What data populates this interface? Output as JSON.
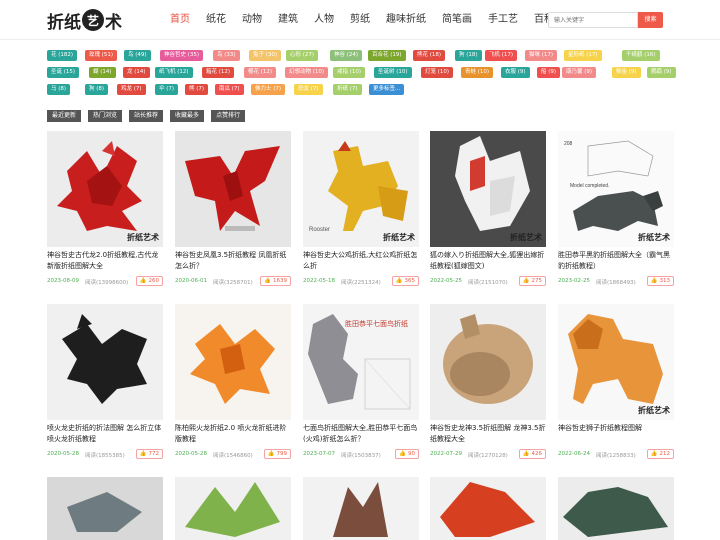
{
  "site": {
    "logo_part1": "折纸",
    "logo_circle": "艺",
    "logo_part2": "术"
  },
  "nav": [
    "首页",
    "纸花",
    "动物",
    "建筑",
    "人物",
    "剪纸",
    "趣味折纸",
    "简笔画",
    "手工艺",
    "百科"
  ],
  "search": {
    "placeholder": "输入关键字",
    "button": "搜索"
  },
  "tags": [
    {
      "label": "花 (182)",
      "color": "#2aa59a"
    },
    {
      "label": "玫瑰 (51)",
      "color": "#ee5a4a"
    },
    {
      "label": "鸟 (49)",
      "color": "#2aa59a"
    },
    {
      "label": "神谷哲史 (35)",
      "color": "#e65b9a"
    },
    {
      "label": "鸟 (33)",
      "color": "#f28a8a"
    },
    {
      "label": "兔子 (30)",
      "color": "#f4c46a"
    },
    {
      "label": "心形 (27)",
      "color": "#a5cf6b"
    },
    {
      "label": "神谷 (24)",
      "color": "#8dc07a"
    },
    {
      "label": "百合花 (19)",
      "color": "#7da62c"
    },
    {
      "label": "熊花 (18)",
      "color": "#e04a3f"
    },
    {
      "label": "狗 (18)",
      "color": "#2aa59a"
    },
    {
      "label": "飞机 (17)",
      "color": "#ef4f4f"
    },
    {
      "label": "猫咪 (17)",
      "color": "#f28a8a"
    },
    {
      "label": "星形纸 (17)",
      "color": "#f6d34a"
    },
    {
      "label": "千纸鹤 (16)",
      "color": "#a5cf6b"
    },
    {
      "label": "圣诞 (15)",
      "color": "#2aa59a"
    },
    {
      "label": "蝴 (14)",
      "color": "#7da62c"
    },
    {
      "label": "龙 (14)",
      "color": "#e04a3f"
    },
    {
      "label": "纸飞机 (12)",
      "color": "#2aa59a"
    },
    {
      "label": "箱花 (12)",
      "color": "#e04a3f"
    },
    {
      "label": "樱花 (12)",
      "color": "#f28a8a"
    },
    {
      "label": "幻想动物 (10)",
      "color": "#f28a8a"
    },
    {
      "label": "戒指 (10)",
      "color": "#a5cf6b"
    },
    {
      "label": "圣诞树 (10)",
      "color": "#2aa59a"
    },
    {
      "label": "灯笼 (10)",
      "color": "#e04a3f"
    },
    {
      "label": "青蛙 (10)",
      "color": "#e8922c"
    },
    {
      "label": "衣服 (9)",
      "color": "#2aa59a"
    },
    {
      "label": "船 (9)",
      "color": "#ef4f4f"
    },
    {
      "label": "康乃馨 (9)",
      "color": "#f28a8a"
    },
    {
      "label": "郁金 (9)",
      "color": "#f6d34a"
    },
    {
      "label": "鹦鹉 (9)",
      "color": "#a5cf6b"
    },
    {
      "label": "马 (8)",
      "color": "#2aa59a"
    },
    {
      "label": "狗 (8)",
      "color": "#2aa59a"
    },
    {
      "label": "鸡龙 (7)",
      "color": "#e04a3f"
    },
    {
      "label": "伞 (7)",
      "color": "#2aa59a"
    },
    {
      "label": "熊 (7)",
      "color": "#e04a3f"
    },
    {
      "label": "南瓜 (7)",
      "color": "#ef4f4f"
    },
    {
      "label": "佛力士 (7)",
      "color": "#f6a24a"
    },
    {
      "label": "恐龙 (7)",
      "color": "#f6d34a"
    },
    {
      "label": "折纸 (7)",
      "color": "#a5cf6b"
    },
    {
      "label": "更多标签...",
      "color": "#3b8fd4"
    }
  ],
  "filters": [
    "最近更新",
    "热门浏览",
    "站长推荐",
    "收藏最多",
    "点赞排行"
  ],
  "cards": [
    {
      "title": "神谷哲史古代龙2.0折纸教程,古代龙新版折纸图解大全",
      "date": "2023-08-09",
      "reads": "阅读(13998600)",
      "likes": "260"
    },
    {
      "title": "神谷哲史凤凰3.5折纸教程 凤凰折纸怎么折？",
      "date": "2020-06-01",
      "reads": "阅读(3258701)",
      "likes": "1639"
    },
    {
      "title": "神谷哲史大公鸡折纸,大红公鸡折纸怎么折",
      "date": "2022-05-18",
      "reads": "阅读(2251324)",
      "likes": "365"
    },
    {
      "title": "狐の嫁入り折纸图解大全,狐狸出嫁折纸教程(狐嫁图文)",
      "date": "2022-05-25",
      "reads": "阅读(2151070)",
      "likes": "275"
    },
    {
      "title": "胜田恭平黑豹折纸图解大全（霸气黑豹折纸教程）",
      "date": "2023-02-25",
      "reads": "阅读(1868493)",
      "likes": "313"
    },
    {
      "title": "喷火龙史折纸的折法图解 怎么折立体喷火龙折纸教程",
      "date": "2020-05-28",
      "reads": "阅读(1855385)",
      "likes": "772"
    },
    {
      "title": "陈柏熙火龙折纸2.0 喷火龙折纸进阶版教程",
      "date": "2020-05-28",
      "reads": "阅读(1546860)",
      "likes": "799"
    },
    {
      "title": "七面鸟折纸图解大全,胜田恭平七面鸟(火鸡)折纸怎么折？",
      "date": "2023-07-07",
      "reads": "阅读(1503837)",
      "likes": "90"
    },
    {
      "title": "神谷哲史龙神3.5折纸图解 龙神3.5折纸教程大全",
      "date": "2022-07-29",
      "reads": "阅读(1270128)",
      "likes": "426"
    },
    {
      "title": "神谷哲史狮子折纸教程图解",
      "date": "2022-06-24",
      "reads": "阅读(1258833)",
      "likes": "212"
    }
  ],
  "overlays": {
    "watermark": "折纸艺术",
    "card3_caption": "Rooster",
    "card5_caption": "Model completed.",
    "card5_number": "208",
    "card8_header": "胜田恭平七面鸟折纸"
  }
}
